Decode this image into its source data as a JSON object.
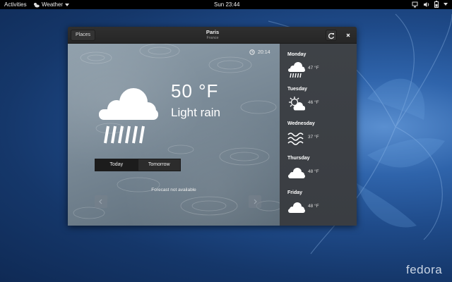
{
  "topbar": {
    "activities": "Activities",
    "app_name": "Weather",
    "clock": "Sun 23:44"
  },
  "window": {
    "places_label": "Places",
    "title": "Paris",
    "subtitle": "France"
  },
  "current": {
    "updated_time": "20:14",
    "temperature": "50 °F",
    "condition": "Light rain",
    "icon": "rain-cloud-icon"
  },
  "day_tabs": {
    "today": "Today",
    "tomorrow": "Tomorrow",
    "selected": "Today"
  },
  "forecast_message": "Forecast not available",
  "forecast": [
    {
      "day": "Monday",
      "temp": "47 °F",
      "icon": "rain-icon"
    },
    {
      "day": "Tuesday",
      "temp": "46 °F",
      "icon": "sun-cloud-icon"
    },
    {
      "day": "Wednesday",
      "temp": "37 °F",
      "icon": "fog-icon"
    },
    {
      "day": "Thursday",
      "temp": "48 °F",
      "icon": "cloud-icon"
    },
    {
      "day": "Friday",
      "temp": "48 °F",
      "icon": "cloud-icon"
    }
  ],
  "desktop_logo": "fedora"
}
